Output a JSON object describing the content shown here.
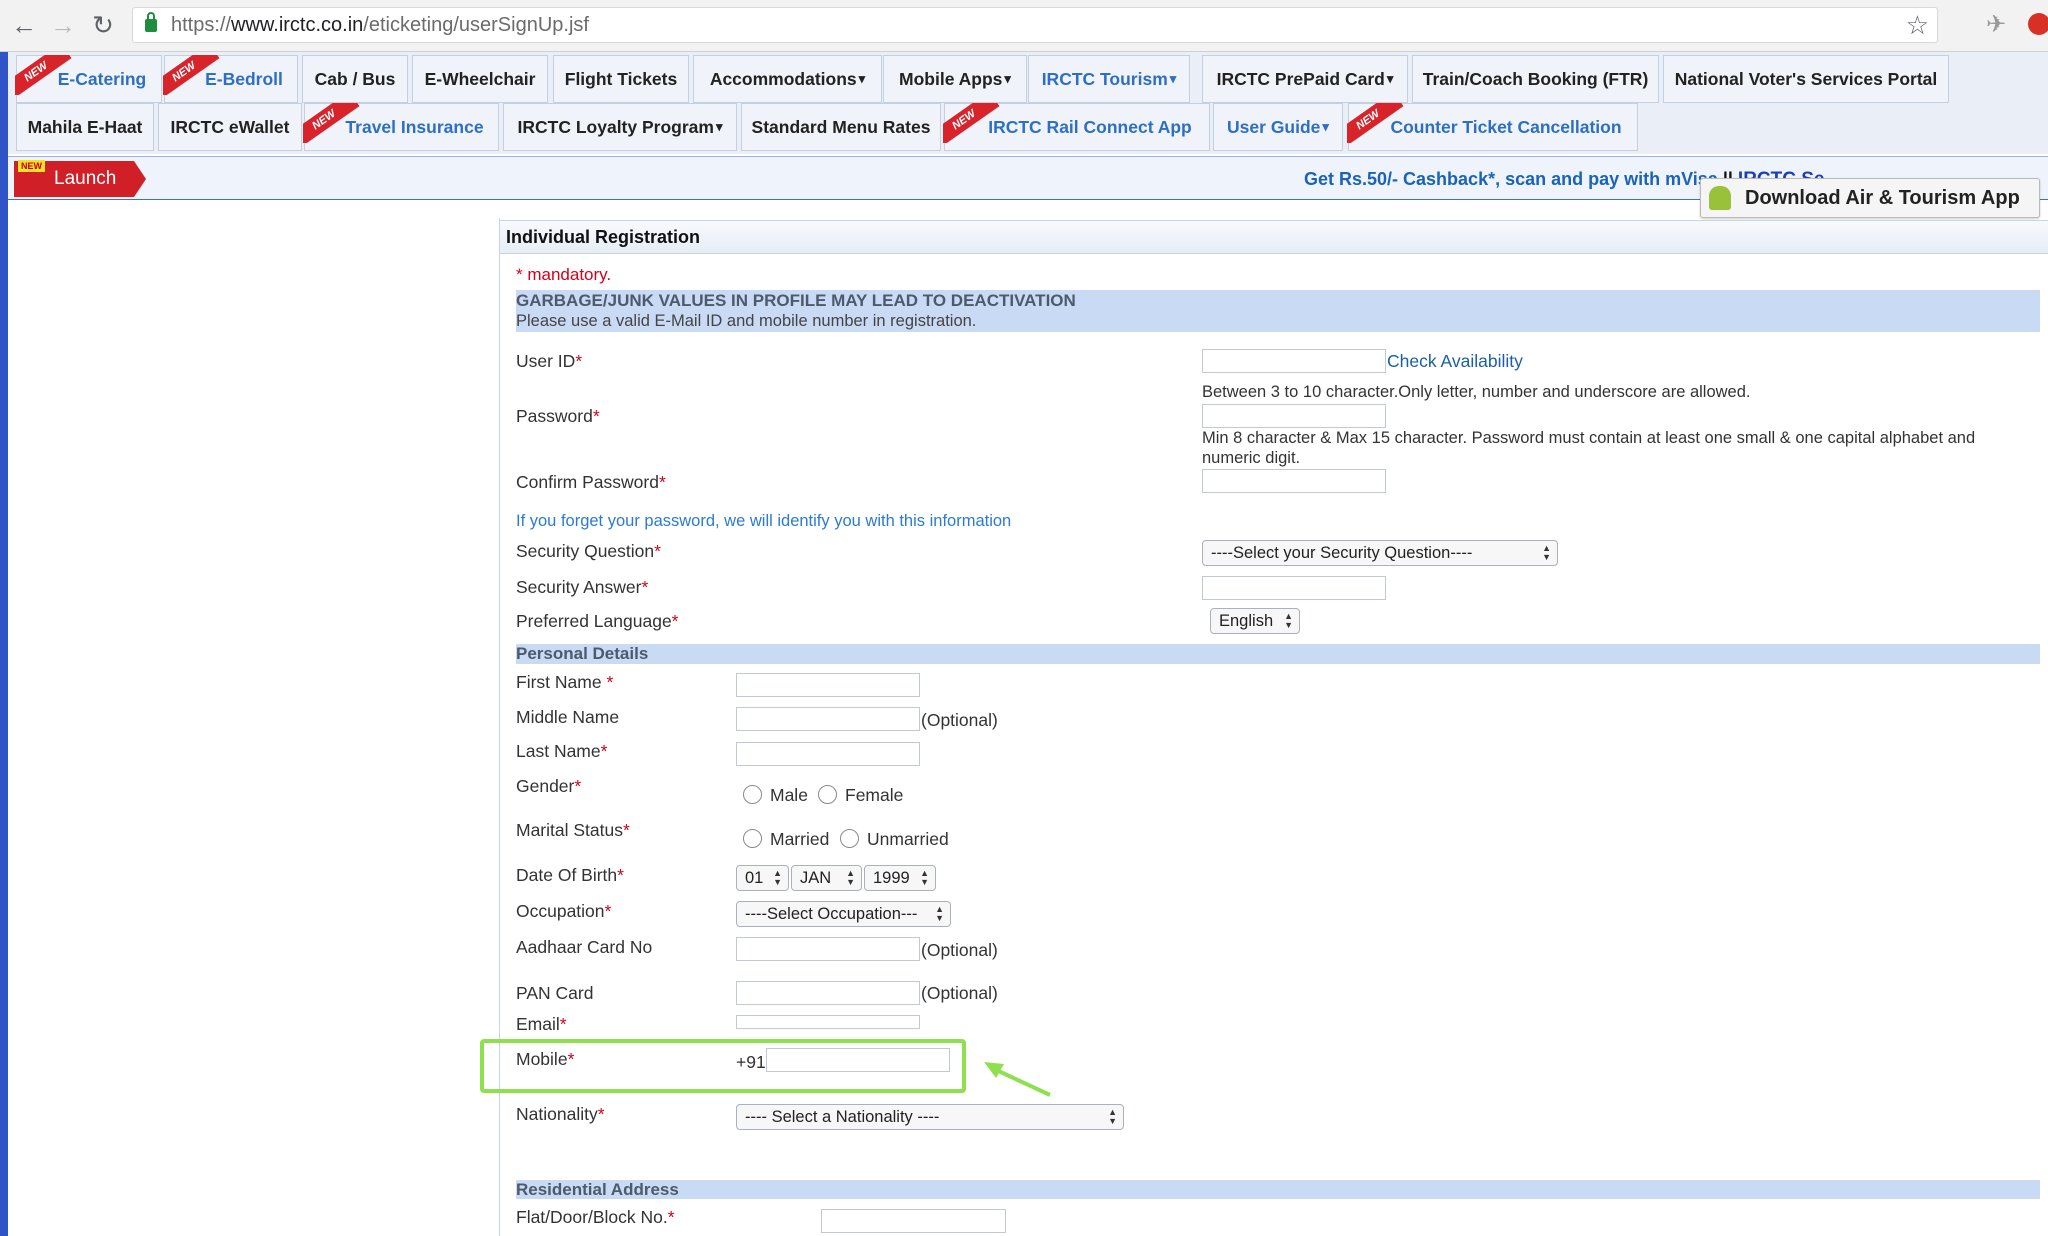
{
  "browser": {
    "url_scheme": "https://",
    "url_domain": "www.irctc.co.in",
    "url_path": "/eticketing/userSignUp.jsf",
    "back_icon": "back-arrow-icon",
    "forward_icon": "forward-arrow-icon",
    "reload_icon": "reload-icon",
    "bookmark_icon": "star-icon"
  },
  "menu": {
    "row1": [
      {
        "label": "E-Catering",
        "new": true,
        "blue": true
      },
      {
        "label": "E-Bedroll",
        "new": true,
        "blue": true
      },
      {
        "label": "Cab / Bus"
      },
      {
        "label": "E-Wheelchair"
      },
      {
        "label": "Flight Tickets"
      },
      {
        "label": "Accommodations",
        "caret": "▾"
      },
      {
        "label": "Mobile Apps",
        "caret": "▾"
      },
      {
        "label": "IRCTC Tourism",
        "caret": " ▾",
        "blue": true
      },
      {
        "label": "IRCTC PrePaid Card",
        "caret": "▾"
      },
      {
        "label": "Train/Coach Booking (FTR)"
      },
      {
        "label": "National Voter's Services Portal"
      }
    ],
    "row2": [
      {
        "label": "Mahila E-Haat"
      },
      {
        "label": "IRCTC eWallet"
      },
      {
        "label": "Travel Insurance",
        "new": true,
        "blue": true
      },
      {
        "label": "IRCTC Loyalty Program",
        "caret": "▾"
      },
      {
        "label": "Standard Menu Rates"
      },
      {
        "label": "IRCTC Rail Connect App",
        "new": true,
        "blue": true
      },
      {
        "label": "User Guide",
        "caret": " ▾",
        "blue": true
      },
      {
        "label": "Counter Ticket Cancellation",
        "new": true,
        "blue": true
      }
    ],
    "new_badge": "NEW"
  },
  "launch": {
    "label": "Launch",
    "badge": "NEW"
  },
  "marquee": {
    "text": "Get Rs.50/- Cashback*, scan and pay with mVisa",
    "sep": " || ",
    "tail": "IRCTC Se"
  },
  "app_button": {
    "label": "Download Air & Tourism App",
    "icon": "android-icon"
  },
  "form": {
    "title": "Individual Registration",
    "mandatory": "* mandatory.",
    "warning_title": "GARBAGE/JUNK VALUES IN PROFILE MAY LEAD TO DEACTIVATION",
    "warning_text": "Please use a valid E-Mail ID and mobile number in registration.",
    "user_id": "User ID",
    "check_availability": "Check Availability",
    "user_id_hint": "Between 3 to 10 character.Only letter, number and underscore are allowed.",
    "password": "Password",
    "password_hint_1": "Min 8 character & Max 15 character. Password must contain at least one small & one capital alphabet and",
    "password_hint_2": "numeric digit.",
    "confirm_password": "Confirm Password",
    "forgot_info": "If you forget your password, we will identify you with this information",
    "security_question": "Security Question",
    "security_question_value": "----Select your Security Question----",
    "security_answer": "Security Answer",
    "preferred_language": "Preferred Language",
    "preferred_language_value": "English",
    "personal_details": "Personal Details",
    "first_name": "First Name ",
    "middle_name": "Middle Name",
    "last_name": "Last Name",
    "optional": "(Optional)",
    "gender": "Gender",
    "male": "Male",
    "female": "Female",
    "marital_status": "Marital Status",
    "married": "Married",
    "unmarried": "Unmarried",
    "dob": "Date Of Birth",
    "dob_day": "01",
    "dob_month": "JAN",
    "dob_year": "1999",
    "occupation": "Occupation",
    "occupation_value": "----Select Occupation---",
    "aadhaar": "Aadhaar Card No",
    "pan": "PAN Card",
    "email": "Email",
    "mobile": "Mobile",
    "mobile_prefix": "+91",
    "nationality": "Nationality",
    "nationality_value": "---- Select a Nationality ----",
    "residential_address": "Residential Address",
    "flat": "Flat/Door/Block No.",
    "star": "*"
  },
  "colors": {
    "highlight": "#8ee04f",
    "band": "#c9daf5",
    "launch_red": "#d01f27",
    "link_blue": "#1a5fa8"
  }
}
